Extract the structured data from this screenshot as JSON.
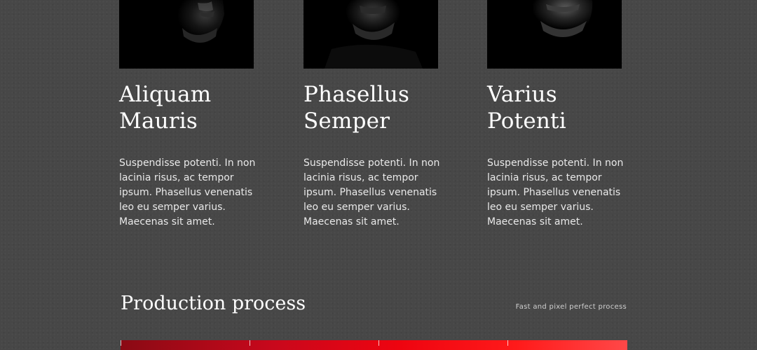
{
  "team": {
    "members": [
      {
        "name": "Aliquam Mauris",
        "bio": "Suspendisse potenti. In non lacinia risus, ac tempor ipsum. Phasellus venenatis leo eu semper varius. Maecenas sit amet."
      },
      {
        "name": "Phasellus Semper",
        "bio": "Suspendisse potenti. In non lacinia risus, ac tempor ipsum. Phasellus venenatis leo eu semper varius. Maecenas sit amet."
      },
      {
        "name": "Varius Potenti",
        "bio": "Suspendisse potenti. In non lacinia risus, ac tempor ipsum. Phasellus venenatis leo eu semper varius. Maecenas sit amet."
      }
    ]
  },
  "process": {
    "title": "Production process",
    "subtitle": "Fast and pixel perfect process"
  },
  "colors": {
    "background": "#474747",
    "accent_dark": "#8a0a14",
    "accent": "#ee0410",
    "accent_light": "#ff4848"
  }
}
